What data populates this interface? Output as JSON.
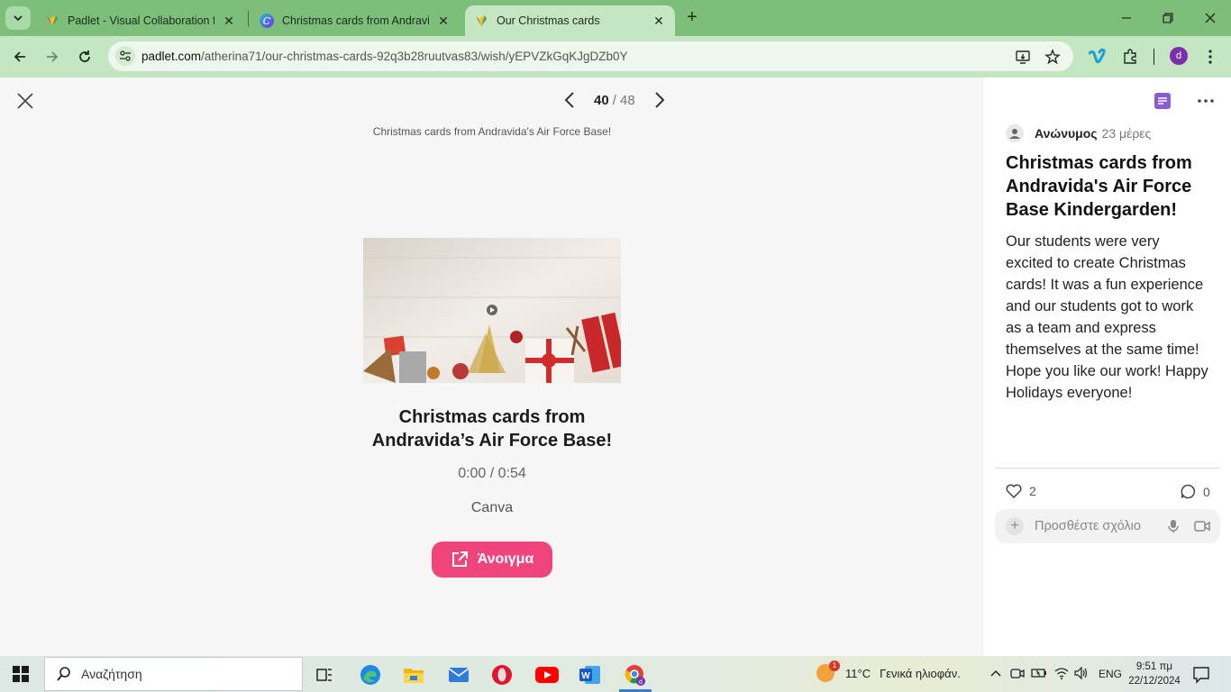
{
  "browser": {
    "tabs": [
      {
        "title": "Padlet - Visual Collaboration fo",
        "favicon": "padlet-icon",
        "active": false
      },
      {
        "title": "Christmas cards from Andravida",
        "favicon": "canva-icon",
        "active": false
      },
      {
        "title": "Our Christmas cards",
        "favicon": "padlet-icon",
        "active": true
      }
    ],
    "url_host": "padlet.com",
    "url_path": "/atherina71/our-christmas-cards-92q3b28ruutvas83/wish/yEPVZkGqKJgDZb0Y",
    "profile_initial": "d"
  },
  "post": {
    "page_current": "40",
    "page_total": "/ 48",
    "embed_subtitle": "Christmas cards from Andravida's Air Force Base!",
    "card_title": "Christmas cards from Andravida’s Air Force Base!",
    "duration": "0:00 / 0:54",
    "source": "Canva",
    "open_label": "Άνοιγμα"
  },
  "panel": {
    "author": "Ανώνυμος",
    "time": "23 μέρες",
    "title": "Christmas cards from Andravida's Air Force Base Kindergarden!",
    "body": "Our students were very excited to create Christmas cards! It was a fun experience and our students got to work as a team and express themselves at the same time! Hope you like our work! Happy Holidays everyone!",
    "likes": "2",
    "comments": "0",
    "comment_placeholder": "Προσθέστε σχόλιο"
  },
  "taskbar": {
    "search_label": "Αναζήτηση",
    "weather_temp": "11°C",
    "weather_desc": "Γενικά ηλιοφάν.",
    "weather_badge": "1",
    "language": "ENG",
    "time": "9:51 πμ",
    "date": "22/12/2024"
  },
  "colors": {
    "accent_pink": "#f0447c",
    "browser_green": "#7dbf7a",
    "panel_icon_purple": "#8e5bd6"
  }
}
